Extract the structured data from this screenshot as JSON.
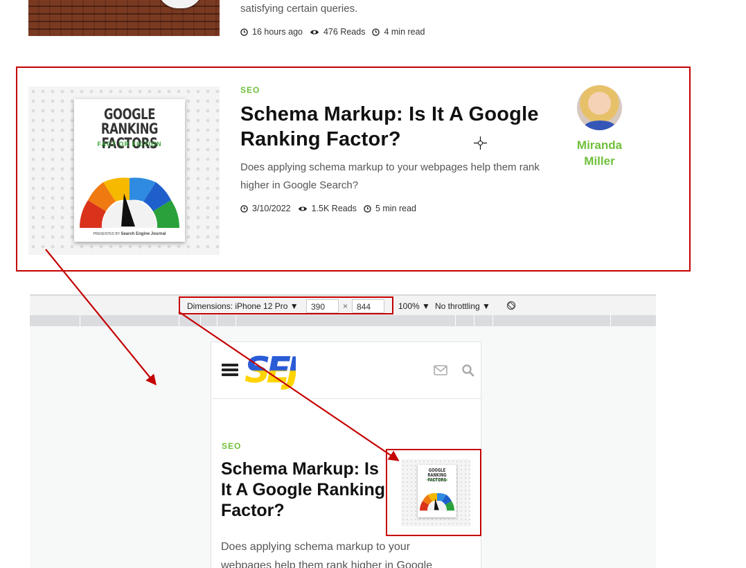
{
  "top_article": {
    "excerpt_tail": "satisfying certain queries.",
    "time": "16 hours ago",
    "reads": "476 Reads",
    "read_time": "4 min read"
  },
  "main_article": {
    "category": "SEO",
    "title": "Schema Markup: Is It A Google Ranking Factor?",
    "excerpt": "Does applying schema markup to your webpages help them rank higher in Google Search?",
    "date": "3/10/2022",
    "reads": "1.5K Reads",
    "read_time": "5 min read",
    "author": "Miranda Miller",
    "cover": {
      "title_line1": "GOOGLE",
      "title_line2": "RANKING FACTORS",
      "subtitle": "FACT OR FICTION",
      "footer_prefix": "PRESENTED BY",
      "footer_brand": "Search Engine Journal"
    }
  },
  "devtools": {
    "dimensions": "Dimensions: iPhone 12 Pro ▼",
    "width": "390",
    "times": "×",
    "height": "844",
    "zoom": "100% ▼",
    "throttling": "No throttling ▼"
  },
  "mobile_preview": {
    "logo": "SEJ",
    "category": "SEO",
    "title": "Schema Markup: Is It A Google Ranking Factor?",
    "excerpt": "Does applying schema markup to your webpages help them rank higher in Google",
    "cover": {
      "title_line1": "GOOGLE",
      "title_line2": "RANKING FACTORS",
      "subtitle": "FACT OR FICTION"
    }
  },
  "colors": {
    "accent_green": "#6fbf3a",
    "highlight_red": "#c40000",
    "logo_blue": "#2a5bd7",
    "logo_yellow": "#ffd400"
  }
}
